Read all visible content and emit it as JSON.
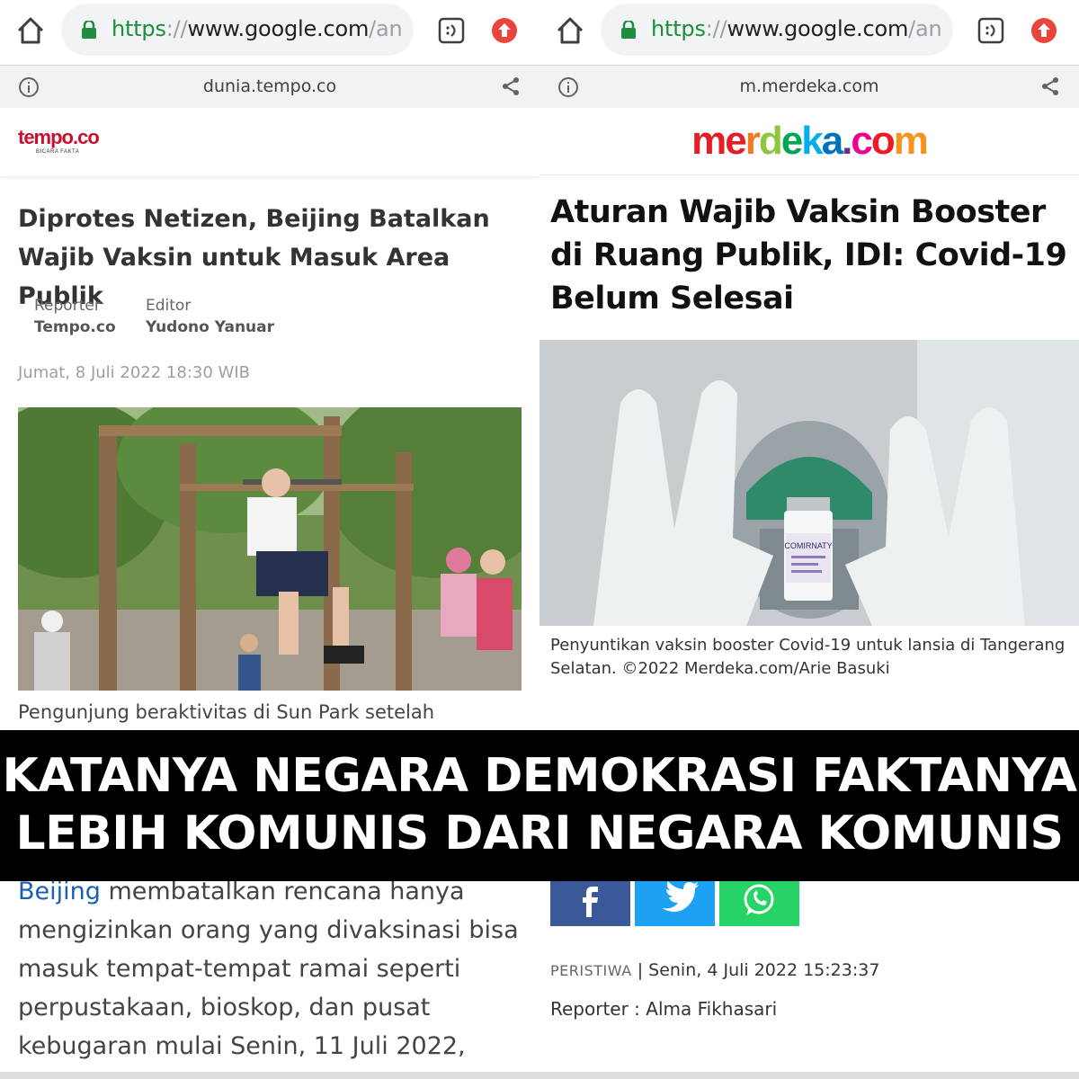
{
  "left": {
    "browser": {
      "url_scheme": "https",
      "url_slashes": "://",
      "url_host": "www.google.com",
      "url_rest": "/an"
    },
    "info_bar": {
      "domain": "dunia.tempo.co"
    },
    "site": {
      "logo": "tempo.co",
      "tagline": "BICARA FAKTA",
      "logo_color": "#c8102e"
    },
    "article": {
      "title": "Diprotes Netizen, Beijing Batalkan Wajib Vaksin untuk Masuk Area Publik",
      "reporter_label": "Reporter",
      "reporter_name": "Tempo.co",
      "editor_label": "Editor",
      "editor_name": "Yudono Yanuar",
      "date": "Jumat, 8 Juli 2022 18:30 WIB",
      "photo_caption": "Pengunjung beraktivitas di Sun Park setelah",
      "body_link": "Beijing",
      "body_text": " membatalkan rencana hanya mengizinkan orang yang divaksinasi bisa masuk tempat-tempat ramai seperti perpustakaan, bioskop, dan pusat kebugaran mulai Senin, 11 Juli 2022,"
    }
  },
  "right": {
    "browser": {
      "url_scheme": "https",
      "url_slashes": "://",
      "url_host": "www.google.com",
      "url_rest": "/an"
    },
    "info_bar": {
      "domain": "m.merdeka.com"
    },
    "site": {
      "logo_letters": [
        "m",
        "e",
        "r",
        "d",
        "e",
        "k",
        "a",
        ".",
        "c",
        "o",
        "m"
      ],
      "logo_colors": [
        "#e41e26",
        "#e41e26",
        "#f47920",
        "#8dc63f",
        "#00a651",
        "#00aeef",
        "#0072bc",
        "#662d91",
        "#ec008c",
        "#ed1c24",
        "#f7941d"
      ]
    },
    "article": {
      "title": "Aturan Wajib Vaksin Booster di Ruang Publik, IDI: Covid-19 Belum Selesai",
      "photo_caption": "Penyuntikan vaksin booster Covid-19 untuk lansia di Tangerang Selatan. ©2022 Merdeka.com/Arie Basuki",
      "vial_label": "COMIRNATY",
      "category": "PERISTIWA",
      "separator": "|",
      "date": "Senin, 4 Juli 2022 15:23:37",
      "reporter": "Reporter : Alma Fikhasari"
    },
    "share": {
      "facebook_color": "#3b5998",
      "twitter_color": "#1da1f2",
      "whatsapp_color": "#25d366"
    }
  },
  "banner": {
    "line1": "KATANYA NEGARA DEMOKRASI FAKTANYA",
    "line2": "LEBIH KOMUNIS DARI NEGARA KOMUNIS"
  }
}
